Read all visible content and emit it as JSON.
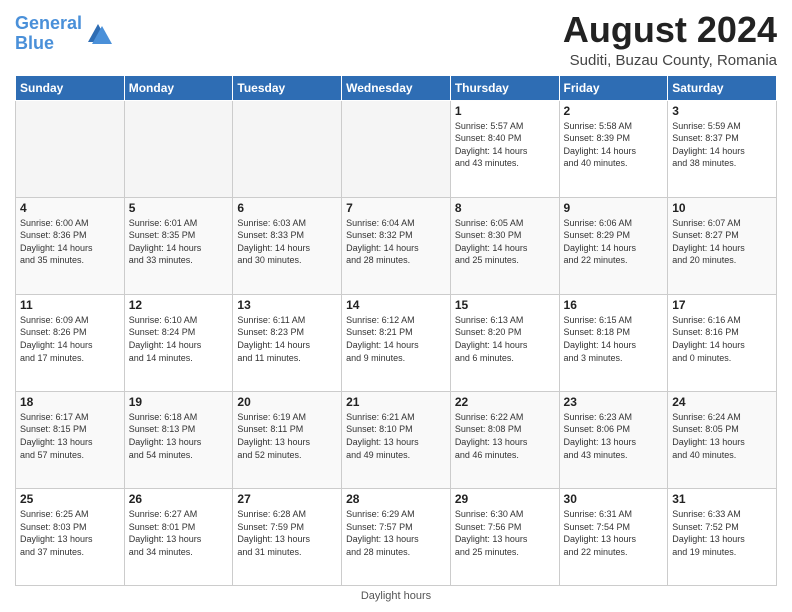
{
  "header": {
    "logo_line1": "General",
    "logo_line2": "Blue",
    "month_title": "August 2024",
    "subtitle": "Suditi, Buzau County, Romania"
  },
  "days_of_week": [
    "Sunday",
    "Monday",
    "Tuesday",
    "Wednesday",
    "Thursday",
    "Friday",
    "Saturday"
  ],
  "weeks": [
    [
      {
        "num": "",
        "info": ""
      },
      {
        "num": "",
        "info": ""
      },
      {
        "num": "",
        "info": ""
      },
      {
        "num": "",
        "info": ""
      },
      {
        "num": "1",
        "info": "Sunrise: 5:57 AM\nSunset: 8:40 PM\nDaylight: 14 hours\nand 43 minutes."
      },
      {
        "num": "2",
        "info": "Sunrise: 5:58 AM\nSunset: 8:39 PM\nDaylight: 14 hours\nand 40 minutes."
      },
      {
        "num": "3",
        "info": "Sunrise: 5:59 AM\nSunset: 8:37 PM\nDaylight: 14 hours\nand 38 minutes."
      }
    ],
    [
      {
        "num": "4",
        "info": "Sunrise: 6:00 AM\nSunset: 8:36 PM\nDaylight: 14 hours\nand 35 minutes."
      },
      {
        "num": "5",
        "info": "Sunrise: 6:01 AM\nSunset: 8:35 PM\nDaylight: 14 hours\nand 33 minutes."
      },
      {
        "num": "6",
        "info": "Sunrise: 6:03 AM\nSunset: 8:33 PM\nDaylight: 14 hours\nand 30 minutes."
      },
      {
        "num": "7",
        "info": "Sunrise: 6:04 AM\nSunset: 8:32 PM\nDaylight: 14 hours\nand 28 minutes."
      },
      {
        "num": "8",
        "info": "Sunrise: 6:05 AM\nSunset: 8:30 PM\nDaylight: 14 hours\nand 25 minutes."
      },
      {
        "num": "9",
        "info": "Sunrise: 6:06 AM\nSunset: 8:29 PM\nDaylight: 14 hours\nand 22 minutes."
      },
      {
        "num": "10",
        "info": "Sunrise: 6:07 AM\nSunset: 8:27 PM\nDaylight: 14 hours\nand 20 minutes."
      }
    ],
    [
      {
        "num": "11",
        "info": "Sunrise: 6:09 AM\nSunset: 8:26 PM\nDaylight: 14 hours\nand 17 minutes."
      },
      {
        "num": "12",
        "info": "Sunrise: 6:10 AM\nSunset: 8:24 PM\nDaylight: 14 hours\nand 14 minutes."
      },
      {
        "num": "13",
        "info": "Sunrise: 6:11 AM\nSunset: 8:23 PM\nDaylight: 14 hours\nand 11 minutes."
      },
      {
        "num": "14",
        "info": "Sunrise: 6:12 AM\nSunset: 8:21 PM\nDaylight: 14 hours\nand 9 minutes."
      },
      {
        "num": "15",
        "info": "Sunrise: 6:13 AM\nSunset: 8:20 PM\nDaylight: 14 hours\nand 6 minutes."
      },
      {
        "num": "16",
        "info": "Sunrise: 6:15 AM\nSunset: 8:18 PM\nDaylight: 14 hours\nand 3 minutes."
      },
      {
        "num": "17",
        "info": "Sunrise: 6:16 AM\nSunset: 8:16 PM\nDaylight: 14 hours\nand 0 minutes."
      }
    ],
    [
      {
        "num": "18",
        "info": "Sunrise: 6:17 AM\nSunset: 8:15 PM\nDaylight: 13 hours\nand 57 minutes."
      },
      {
        "num": "19",
        "info": "Sunrise: 6:18 AM\nSunset: 8:13 PM\nDaylight: 13 hours\nand 54 minutes."
      },
      {
        "num": "20",
        "info": "Sunrise: 6:19 AM\nSunset: 8:11 PM\nDaylight: 13 hours\nand 52 minutes."
      },
      {
        "num": "21",
        "info": "Sunrise: 6:21 AM\nSunset: 8:10 PM\nDaylight: 13 hours\nand 49 minutes."
      },
      {
        "num": "22",
        "info": "Sunrise: 6:22 AM\nSunset: 8:08 PM\nDaylight: 13 hours\nand 46 minutes."
      },
      {
        "num": "23",
        "info": "Sunrise: 6:23 AM\nSunset: 8:06 PM\nDaylight: 13 hours\nand 43 minutes."
      },
      {
        "num": "24",
        "info": "Sunrise: 6:24 AM\nSunset: 8:05 PM\nDaylight: 13 hours\nand 40 minutes."
      }
    ],
    [
      {
        "num": "25",
        "info": "Sunrise: 6:25 AM\nSunset: 8:03 PM\nDaylight: 13 hours\nand 37 minutes."
      },
      {
        "num": "26",
        "info": "Sunrise: 6:27 AM\nSunset: 8:01 PM\nDaylight: 13 hours\nand 34 minutes."
      },
      {
        "num": "27",
        "info": "Sunrise: 6:28 AM\nSunset: 7:59 PM\nDaylight: 13 hours\nand 31 minutes."
      },
      {
        "num": "28",
        "info": "Sunrise: 6:29 AM\nSunset: 7:57 PM\nDaylight: 13 hours\nand 28 minutes."
      },
      {
        "num": "29",
        "info": "Sunrise: 6:30 AM\nSunset: 7:56 PM\nDaylight: 13 hours\nand 25 minutes."
      },
      {
        "num": "30",
        "info": "Sunrise: 6:31 AM\nSunset: 7:54 PM\nDaylight: 13 hours\nand 22 minutes."
      },
      {
        "num": "31",
        "info": "Sunrise: 6:33 AM\nSunset: 7:52 PM\nDaylight: 13 hours\nand 19 minutes."
      }
    ]
  ],
  "footer": {
    "label": "Daylight hours"
  }
}
